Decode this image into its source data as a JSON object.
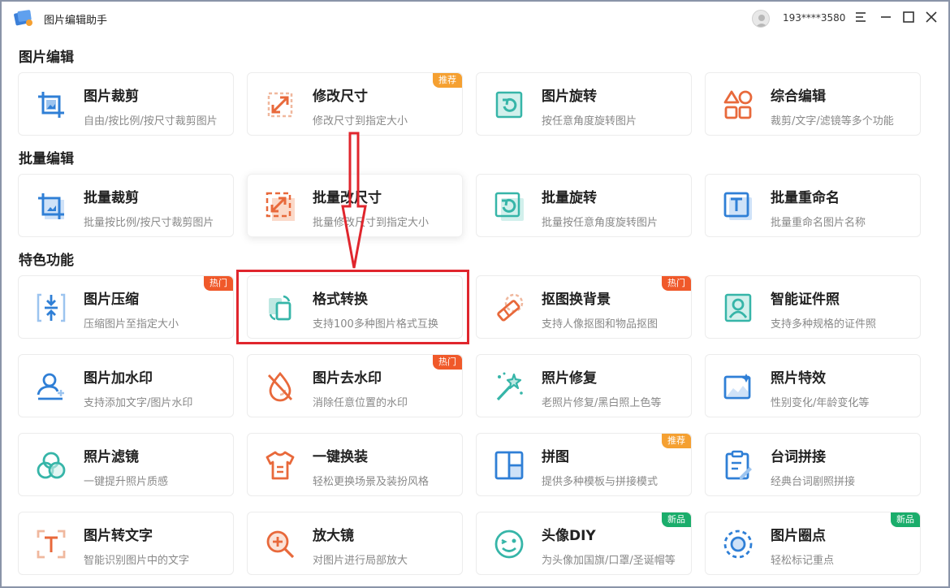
{
  "app": {
    "title": "图片编辑助手",
    "user_phone": "193****3580"
  },
  "sections": [
    {
      "title": "图片编辑",
      "cards": [
        {
          "title": "图片裁剪",
          "desc": "自由/按比例/按尺寸裁剪图片",
          "icon": "crop-icon"
        },
        {
          "title": "修改尺寸",
          "desc": "修改尺寸到指定大小",
          "icon": "resize-icon",
          "badge": "推荐"
        },
        {
          "title": "图片旋转",
          "desc": "按任意角度旋转图片",
          "icon": "rotate-icon"
        },
        {
          "title": "综合编辑",
          "desc": "裁剪/文字/滤镜等多个功能",
          "icon": "shapes-icon"
        }
      ]
    },
    {
      "title": "批量编辑",
      "cards": [
        {
          "title": "批量裁剪",
          "desc": "批量按比例/按尺寸裁剪图片",
          "icon": "batch-crop-icon"
        },
        {
          "title": "批量改尺寸",
          "desc": "批量修改尺寸到指定大小",
          "icon": "batch-resize-icon"
        },
        {
          "title": "批量旋转",
          "desc": "批量按任意角度旋转图片",
          "icon": "batch-rotate-icon"
        },
        {
          "title": "批量重命名",
          "desc": "批量重命名图片名称",
          "icon": "rename-icon"
        }
      ]
    },
    {
      "title": "特色功能",
      "cards": [
        {
          "title": "图片压缩",
          "desc": "压缩图片至指定大小",
          "icon": "compress-icon",
          "badge": "热门"
        },
        {
          "title": "格式转换",
          "desc": "支持100多种图片格式互换",
          "icon": "convert-icon"
        },
        {
          "title": "抠图换背景",
          "desc": "支持人像抠图和物品抠图",
          "icon": "eraser-icon",
          "badge": "热门"
        },
        {
          "title": "智能证件照",
          "desc": "支持多种规格的证件照",
          "icon": "id-photo-icon"
        },
        {
          "title": "图片加水印",
          "desc": "支持添加文字/图片水印",
          "icon": "add-watermark-icon"
        },
        {
          "title": "图片去水印",
          "desc": "消除任意位置的水印",
          "icon": "remove-watermark-icon",
          "badge": "热门"
        },
        {
          "title": "照片修复",
          "desc": "老照片修复/黑白照上色等",
          "icon": "magic-wand-icon"
        },
        {
          "title": "照片特效",
          "desc": "性别变化/年龄变化等",
          "icon": "image-effect-icon"
        },
        {
          "title": "照片滤镜",
          "desc": "一键提升照片质感",
          "icon": "filter-icon"
        },
        {
          "title": "一键换装",
          "desc": "轻松更换场景及装扮风格",
          "icon": "shirt-icon"
        },
        {
          "title": "拼图",
          "desc": "提供多种模板与拼接模式",
          "icon": "collage-icon",
          "badge": "推荐"
        },
        {
          "title": "台词拼接",
          "desc": "经典台词剧照拼接",
          "icon": "clipboard-icon"
        },
        {
          "title": "图片转文字",
          "desc": "智能识别图片中的文字",
          "icon": "ocr-icon"
        },
        {
          "title": "放大镜",
          "desc": "对图片进行局部放大",
          "icon": "zoom-icon"
        },
        {
          "title": "头像DIY",
          "desc": "为头像加国旗/口罩/圣诞帽等",
          "icon": "smile-icon",
          "badge": "新品"
        },
        {
          "title": "图片圈点",
          "desc": "轻松标记重点",
          "icon": "circle-mark-icon",
          "badge": "新品"
        }
      ]
    }
  ],
  "colors": {
    "badge_recommend": "#f5a031",
    "badge_hot": "#f0592a",
    "badge_new": "#1aad6b",
    "highlight": "#e0262d",
    "blue": "#2f7fd6",
    "orange": "#e8693b",
    "teal": "#36b5a8"
  }
}
